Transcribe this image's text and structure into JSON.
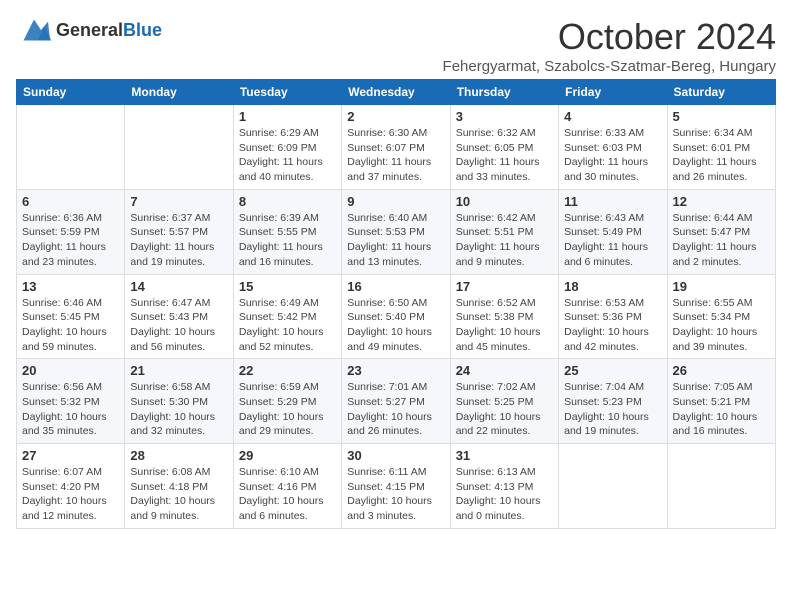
{
  "logo": {
    "general": "General",
    "blue": "Blue"
  },
  "title": {
    "month": "October 2024",
    "location": "Fehergyarmat, Szabolcs-Szatmar-Bereg, Hungary"
  },
  "weekdays": [
    "Sunday",
    "Monday",
    "Tuesday",
    "Wednesday",
    "Thursday",
    "Friday",
    "Saturday"
  ],
  "weeks": [
    [
      {
        "day": "",
        "detail": ""
      },
      {
        "day": "",
        "detail": ""
      },
      {
        "day": "1",
        "detail": "Sunrise: 6:29 AM\nSunset: 6:09 PM\nDaylight: 11 hours and 40 minutes."
      },
      {
        "day": "2",
        "detail": "Sunrise: 6:30 AM\nSunset: 6:07 PM\nDaylight: 11 hours and 37 minutes."
      },
      {
        "day": "3",
        "detail": "Sunrise: 6:32 AM\nSunset: 6:05 PM\nDaylight: 11 hours and 33 minutes."
      },
      {
        "day": "4",
        "detail": "Sunrise: 6:33 AM\nSunset: 6:03 PM\nDaylight: 11 hours and 30 minutes."
      },
      {
        "day": "5",
        "detail": "Sunrise: 6:34 AM\nSunset: 6:01 PM\nDaylight: 11 hours and 26 minutes."
      }
    ],
    [
      {
        "day": "6",
        "detail": "Sunrise: 6:36 AM\nSunset: 5:59 PM\nDaylight: 11 hours and 23 minutes."
      },
      {
        "day": "7",
        "detail": "Sunrise: 6:37 AM\nSunset: 5:57 PM\nDaylight: 11 hours and 19 minutes."
      },
      {
        "day": "8",
        "detail": "Sunrise: 6:39 AM\nSunset: 5:55 PM\nDaylight: 11 hours and 16 minutes."
      },
      {
        "day": "9",
        "detail": "Sunrise: 6:40 AM\nSunset: 5:53 PM\nDaylight: 11 hours and 13 minutes."
      },
      {
        "day": "10",
        "detail": "Sunrise: 6:42 AM\nSunset: 5:51 PM\nDaylight: 11 hours and 9 minutes."
      },
      {
        "day": "11",
        "detail": "Sunrise: 6:43 AM\nSunset: 5:49 PM\nDaylight: 11 hours and 6 minutes."
      },
      {
        "day": "12",
        "detail": "Sunrise: 6:44 AM\nSunset: 5:47 PM\nDaylight: 11 hours and 2 minutes."
      }
    ],
    [
      {
        "day": "13",
        "detail": "Sunrise: 6:46 AM\nSunset: 5:45 PM\nDaylight: 10 hours and 59 minutes."
      },
      {
        "day": "14",
        "detail": "Sunrise: 6:47 AM\nSunset: 5:43 PM\nDaylight: 10 hours and 56 minutes."
      },
      {
        "day": "15",
        "detail": "Sunrise: 6:49 AM\nSunset: 5:42 PM\nDaylight: 10 hours and 52 minutes."
      },
      {
        "day": "16",
        "detail": "Sunrise: 6:50 AM\nSunset: 5:40 PM\nDaylight: 10 hours and 49 minutes."
      },
      {
        "day": "17",
        "detail": "Sunrise: 6:52 AM\nSunset: 5:38 PM\nDaylight: 10 hours and 45 minutes."
      },
      {
        "day": "18",
        "detail": "Sunrise: 6:53 AM\nSunset: 5:36 PM\nDaylight: 10 hours and 42 minutes."
      },
      {
        "day": "19",
        "detail": "Sunrise: 6:55 AM\nSunset: 5:34 PM\nDaylight: 10 hours and 39 minutes."
      }
    ],
    [
      {
        "day": "20",
        "detail": "Sunrise: 6:56 AM\nSunset: 5:32 PM\nDaylight: 10 hours and 35 minutes."
      },
      {
        "day": "21",
        "detail": "Sunrise: 6:58 AM\nSunset: 5:30 PM\nDaylight: 10 hours and 32 minutes."
      },
      {
        "day": "22",
        "detail": "Sunrise: 6:59 AM\nSunset: 5:29 PM\nDaylight: 10 hours and 29 minutes."
      },
      {
        "day": "23",
        "detail": "Sunrise: 7:01 AM\nSunset: 5:27 PM\nDaylight: 10 hours and 26 minutes."
      },
      {
        "day": "24",
        "detail": "Sunrise: 7:02 AM\nSunset: 5:25 PM\nDaylight: 10 hours and 22 minutes."
      },
      {
        "day": "25",
        "detail": "Sunrise: 7:04 AM\nSunset: 5:23 PM\nDaylight: 10 hours and 19 minutes."
      },
      {
        "day": "26",
        "detail": "Sunrise: 7:05 AM\nSunset: 5:21 PM\nDaylight: 10 hours and 16 minutes."
      }
    ],
    [
      {
        "day": "27",
        "detail": "Sunrise: 6:07 AM\nSunset: 4:20 PM\nDaylight: 10 hours and 12 minutes."
      },
      {
        "day": "28",
        "detail": "Sunrise: 6:08 AM\nSunset: 4:18 PM\nDaylight: 10 hours and 9 minutes."
      },
      {
        "day": "29",
        "detail": "Sunrise: 6:10 AM\nSunset: 4:16 PM\nDaylight: 10 hours and 6 minutes."
      },
      {
        "day": "30",
        "detail": "Sunrise: 6:11 AM\nSunset: 4:15 PM\nDaylight: 10 hours and 3 minutes."
      },
      {
        "day": "31",
        "detail": "Sunrise: 6:13 AM\nSunset: 4:13 PM\nDaylight: 10 hours and 0 minutes."
      },
      {
        "day": "",
        "detail": ""
      },
      {
        "day": "",
        "detail": ""
      }
    ]
  ]
}
